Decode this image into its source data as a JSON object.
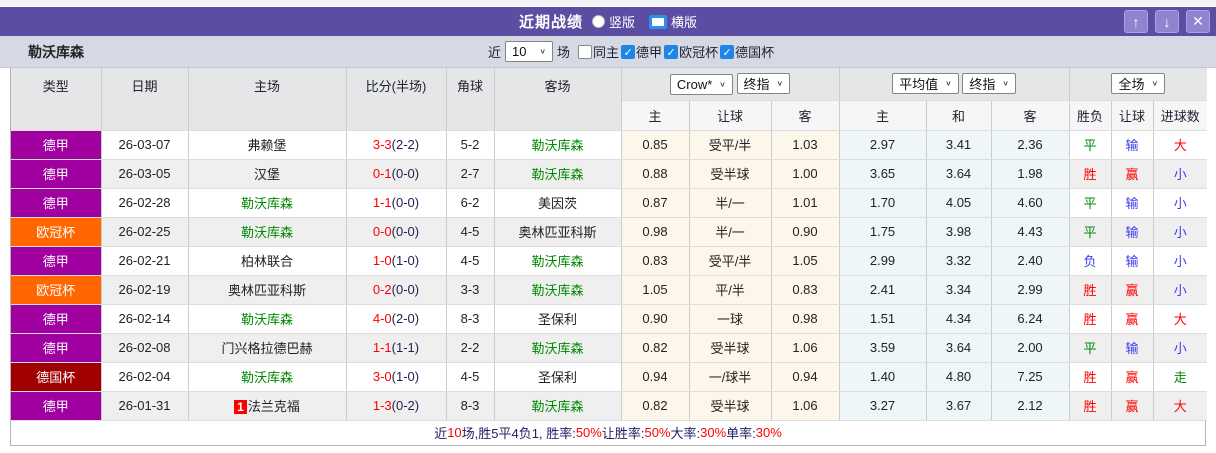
{
  "titlebar": {
    "title": "近期战绩",
    "radios": [
      {
        "label": "竖版",
        "selected": false
      },
      {
        "label": "横版",
        "selected": true
      }
    ],
    "buttons": {
      "up": "↑",
      "down": "↓",
      "close": "✕"
    }
  },
  "filterbar": {
    "team": "勒沃库森",
    "near_label": "近",
    "near_value": "10",
    "games_label": "场",
    "checkboxes": [
      {
        "label": "同主",
        "checked": false
      },
      {
        "label": "德甲",
        "checked": true
      },
      {
        "label": "欧冠杯",
        "checked": true
      },
      {
        "label": "德国杯",
        "checked": true
      }
    ]
  },
  "table": {
    "main_headers": [
      "类型",
      "日期",
      "主场",
      "比分(半场)",
      "角球",
      "客场"
    ],
    "selects": {
      "crow": "Crow*",
      "zhi1": "终指",
      "avg": "平均值",
      "zhi2": "终指",
      "scope": "全场"
    },
    "sub_headers": [
      "主",
      "让球",
      "客",
      "主",
      "和",
      "客",
      "胜负",
      "让球",
      "进球数"
    ],
    "rows": [
      {
        "league": "德甲",
        "league_color": "purple",
        "date": "26-03-07",
        "home": "弗赖堡",
        "home_green": false,
        "home_badge": "",
        "score": "3-3",
        "half": "(2-2)",
        "corner": "5-2",
        "away": "勒沃库森",
        "away_green": true,
        "odds": [
          "0.85",
          "受平/半",
          "1.03"
        ],
        "avg": [
          "2.97",
          "3.41",
          "2.36"
        ],
        "result": {
          "t": "平",
          "c": "green"
        },
        "hresult": {
          "t": "输",
          "c": "blue"
        },
        "goals": {
          "t": "大",
          "c": "red"
        }
      },
      {
        "league": "德甲",
        "league_color": "purple",
        "date": "26-03-05",
        "home": "汉堡",
        "home_green": false,
        "home_badge": "",
        "score": "0-1",
        "half": "(0-0)",
        "corner": "2-7",
        "away": "勒沃库森",
        "away_green": true,
        "odds": [
          "0.88",
          "受半球",
          "1.00"
        ],
        "avg": [
          "3.65",
          "3.64",
          "1.98"
        ],
        "result": {
          "t": "胜",
          "c": "red"
        },
        "hresult": {
          "t": "赢",
          "c": "red"
        },
        "goals": {
          "t": "小",
          "c": "blue"
        }
      },
      {
        "league": "德甲",
        "league_color": "purple",
        "date": "26-02-28",
        "home": "勒沃库森",
        "home_green": true,
        "home_badge": "",
        "score": "1-1",
        "half": "(0-0)",
        "corner": "6-2",
        "away": "美因茨",
        "away_green": false,
        "odds": [
          "0.87",
          "半/一",
          "1.01"
        ],
        "avg": [
          "1.70",
          "4.05",
          "4.60"
        ],
        "result": {
          "t": "平",
          "c": "green"
        },
        "hresult": {
          "t": "输",
          "c": "blue"
        },
        "goals": {
          "t": "小",
          "c": "blue"
        }
      },
      {
        "league": "欧冠杯",
        "league_color": "orange",
        "date": "26-02-25",
        "home": "勒沃库森",
        "home_green": true,
        "home_badge": "",
        "score": "0-0",
        "half": "(0-0)",
        "corner": "4-5",
        "away": "奥林匹亚科斯",
        "away_green": false,
        "odds": [
          "0.98",
          "半/一",
          "0.90"
        ],
        "avg": [
          "1.75",
          "3.98",
          "4.43"
        ],
        "result": {
          "t": "平",
          "c": "green"
        },
        "hresult": {
          "t": "输",
          "c": "blue"
        },
        "goals": {
          "t": "小",
          "c": "blue"
        }
      },
      {
        "league": "德甲",
        "league_color": "purple",
        "date": "26-02-21",
        "home": "柏林联合",
        "home_green": false,
        "home_badge": "",
        "score": "1-0",
        "half": "(1-0)",
        "corner": "4-5",
        "away": "勒沃库森",
        "away_green": true,
        "odds": [
          "0.83",
          "受平/半",
          "1.05"
        ],
        "avg": [
          "2.99",
          "3.32",
          "2.40"
        ],
        "result": {
          "t": "负",
          "c": "blue"
        },
        "hresult": {
          "t": "输",
          "c": "blue"
        },
        "goals": {
          "t": "小",
          "c": "blue"
        }
      },
      {
        "league": "欧冠杯",
        "league_color": "orange",
        "date": "26-02-19",
        "home": "奥林匹亚科斯",
        "home_green": false,
        "home_badge": "",
        "score": "0-2",
        "half": "(0-0)",
        "corner": "3-3",
        "away": "勒沃库森",
        "away_green": true,
        "odds": [
          "1.05",
          "平/半",
          "0.83"
        ],
        "avg": [
          "2.41",
          "3.34",
          "2.99"
        ],
        "result": {
          "t": "胜",
          "c": "red"
        },
        "hresult": {
          "t": "赢",
          "c": "red"
        },
        "goals": {
          "t": "小",
          "c": "blue"
        }
      },
      {
        "league": "德甲",
        "league_color": "purple",
        "date": "26-02-14",
        "home": "勒沃库森",
        "home_green": true,
        "home_badge": "",
        "score": "4-0",
        "half": "(2-0)",
        "corner": "8-3",
        "away": "圣保利",
        "away_green": false,
        "odds": [
          "0.90",
          "一球",
          "0.98"
        ],
        "avg": [
          "1.51",
          "4.34",
          "6.24"
        ],
        "result": {
          "t": "胜",
          "c": "red"
        },
        "hresult": {
          "t": "赢",
          "c": "red"
        },
        "goals": {
          "t": "大",
          "c": "red"
        }
      },
      {
        "league": "德甲",
        "league_color": "purple",
        "date": "26-02-08",
        "home": "门兴格拉德巴赫",
        "home_green": false,
        "home_badge": "",
        "score": "1-1",
        "half": "(1-1)",
        "corner": "2-2",
        "away": "勒沃库森",
        "away_green": true,
        "odds": [
          "0.82",
          "受半球",
          "1.06"
        ],
        "avg": [
          "3.59",
          "3.64",
          "2.00"
        ],
        "result": {
          "t": "平",
          "c": "green"
        },
        "hresult": {
          "t": "输",
          "c": "blue"
        },
        "goals": {
          "t": "小",
          "c": "blue"
        }
      },
      {
        "league": "德国杯",
        "league_color": "darkred",
        "date": "26-02-04",
        "home": "勒沃库森",
        "home_green": true,
        "home_badge": "",
        "score": "3-0",
        "half": "(1-0)",
        "corner": "4-5",
        "away": "圣保利",
        "away_green": false,
        "odds": [
          "0.94",
          "一/球半",
          "0.94"
        ],
        "avg": [
          "1.40",
          "4.80",
          "7.25"
        ],
        "result": {
          "t": "胜",
          "c": "red"
        },
        "hresult": {
          "t": "赢",
          "c": "red"
        },
        "goals": {
          "t": "走",
          "c": "green"
        }
      },
      {
        "league": "德甲",
        "league_color": "purple",
        "date": "26-01-31",
        "home": "法兰克福",
        "home_green": false,
        "home_badge": "1",
        "score": "1-3",
        "half": "(0-2)",
        "corner": "8-3",
        "away": "勒沃库森",
        "away_green": true,
        "odds": [
          "0.82",
          "受半球",
          "1.06"
        ],
        "avg": [
          "3.27",
          "3.67",
          "2.12"
        ],
        "result": {
          "t": "胜",
          "c": "red"
        },
        "hresult": {
          "t": "赢",
          "c": "red"
        },
        "goals": {
          "t": "大",
          "c": "red"
        }
      }
    ]
  },
  "footer": {
    "segments": [
      {
        "t": "近",
        "c": "dark"
      },
      {
        "t": "10",
        "c": "red"
      },
      {
        "t": "场,胜5平4负1, 胜率:",
        "c": "dark"
      },
      {
        "t": "50%",
        "c": "red"
      },
      {
        "t": " 让胜率:",
        "c": "dark"
      },
      {
        "t": "50%",
        "c": "red"
      },
      {
        "t": " 大率:",
        "c": "dark"
      },
      {
        "t": "30%",
        "c": "red"
      },
      {
        "t": " 单率:",
        "c": "dark"
      },
      {
        "t": "30%",
        "c": "red"
      }
    ]
  },
  "colors": {
    "titlebar_bg": "#5a4da2",
    "button_bg": "#8e84cf",
    "checkbox_checked": "#1f86e8",
    "leagues": {
      "purple": "#a000a0",
      "orange": "#ff6600",
      "darkred": "#a00000"
    },
    "team_highlight": "#008800",
    "score_red": "#ff0000",
    "value_blue": "#3a3af0",
    "value_green": "#008800",
    "odds_col_bg": "#fdf6ea",
    "avg_col_bg": "#eef6f9"
  }
}
